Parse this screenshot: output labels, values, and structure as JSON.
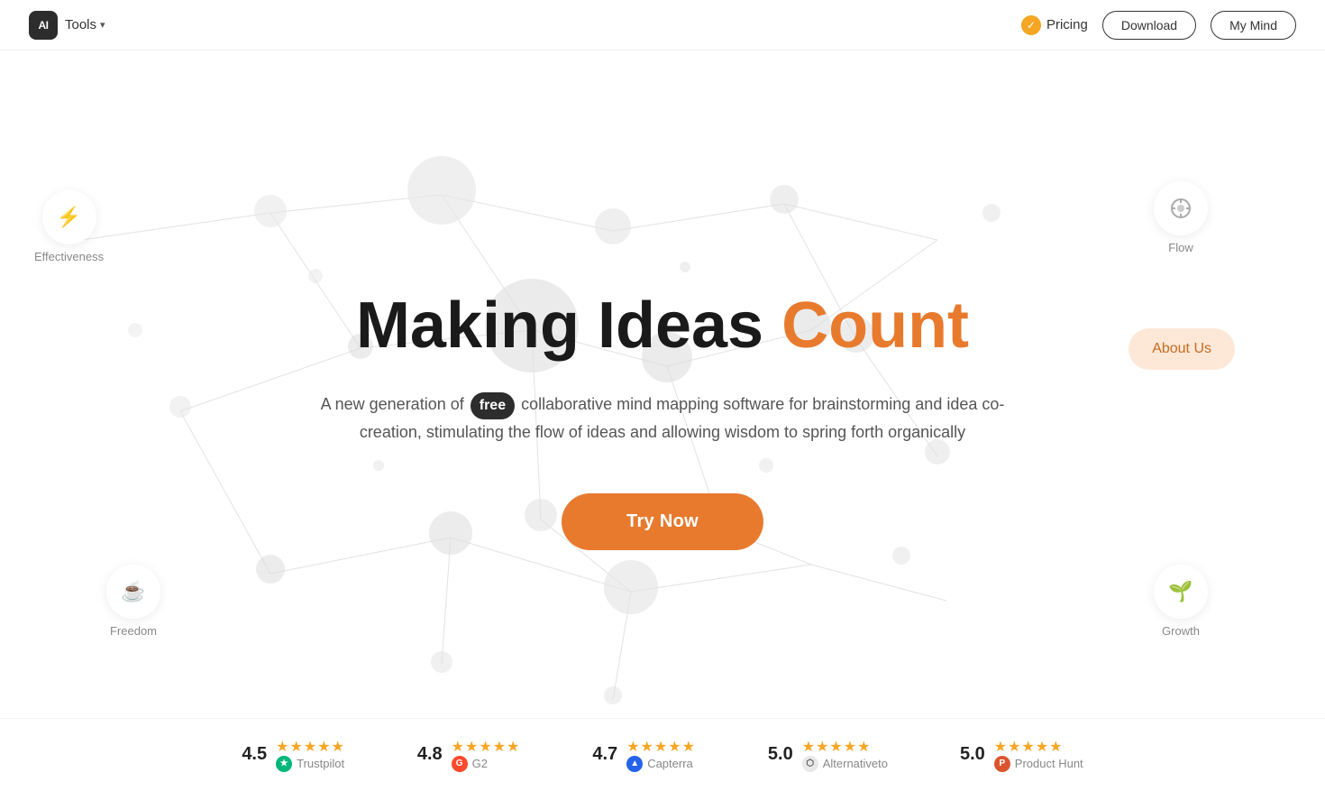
{
  "navbar": {
    "logo_text": "AI",
    "tools_label": "Tools",
    "pricing_label": "Pricing",
    "download_label": "Download",
    "mymind_label": "My Mind"
  },
  "hero": {
    "title_part1": "Making Ideas ",
    "title_orange": "Count",
    "subtitle": "A new generation of collaborative mind mapping software for brainstorming and idea co-creation, stimulating the flow of ideas and allowing wisdom to spring forth organically",
    "free_badge": "free",
    "cta_label": "Try Now",
    "floating_labels": {
      "effectiveness": "Effectiveness",
      "flow": "Flow",
      "about_us": "About Us",
      "freedom": "Freedom",
      "growth": "Growth"
    }
  },
  "ratings": [
    {
      "score": "4.5",
      "stars": "★★★★★",
      "platform": "Trustpilot",
      "icon_type": "trustpilot"
    },
    {
      "score": "4.8",
      "stars": "★★★★★",
      "platform": "G2",
      "icon_type": "g2"
    },
    {
      "score": "4.7",
      "stars": "★★★★★",
      "platform": "Capterra",
      "icon_type": "capterra"
    },
    {
      "score": "5.0",
      "stars": "★★★★★",
      "platform": "Alternativeto",
      "icon_type": "alternativeto"
    },
    {
      "score": "5.0",
      "stars": "★★★★★",
      "platform": "Product Hunt",
      "icon_type": "producthunt"
    }
  ]
}
